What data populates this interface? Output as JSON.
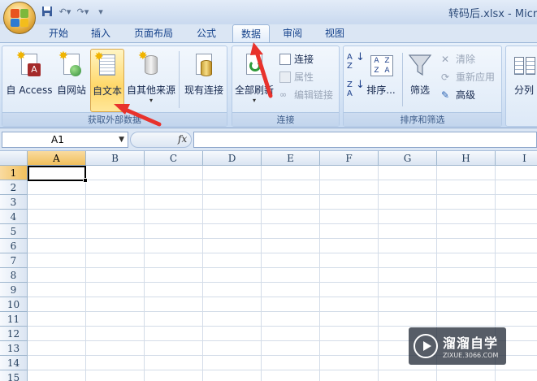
{
  "window": {
    "title": "转码后.xlsx - Micr"
  },
  "tabs": [
    "开始",
    "插入",
    "页面布局",
    "公式",
    "数据",
    "审阅",
    "视图"
  ],
  "active_tab": "数据",
  "ribbon": {
    "external_group": {
      "label": "获取外部数据",
      "buttons": [
        "自 Access",
        "自网站",
        "自文本",
        "自其他来源",
        "现有连接"
      ]
    },
    "connections_group": {
      "label": "连接",
      "refresh_all": "全部刷新",
      "connections": "连接",
      "properties": "属性",
      "edit_links": "编辑链接"
    },
    "sort_group": {
      "label": "排序和筛选",
      "sort": "排序...",
      "filter": "筛选",
      "clear": "清除",
      "reapply": "重新应用",
      "advanced": "高级",
      "sort_az_top": "A",
      "sort_az_bottom": "Z",
      "sort_za_top": "Z",
      "sort_za_bottom": "A"
    },
    "data_tools_group": {
      "split": "分列"
    }
  },
  "formula_bar": {
    "name_box": "A1",
    "fx": "fx",
    "value": ""
  },
  "sheet": {
    "columns": [
      "A",
      "B",
      "C",
      "D",
      "E",
      "F",
      "G",
      "H",
      "I"
    ],
    "rows": [
      "1",
      "2",
      "3",
      "4",
      "5",
      "6",
      "7",
      "8",
      "9",
      "10",
      "11",
      "12",
      "13",
      "14",
      "15"
    ],
    "active_cell": "A1"
  },
  "watermark": {
    "title": "溜溜自学",
    "url": "ZIXUE.3066.COM"
  },
  "colors": {
    "arrow": "#e8322c",
    "selected_header": "#f1c05c",
    "accent": "#15428b"
  }
}
